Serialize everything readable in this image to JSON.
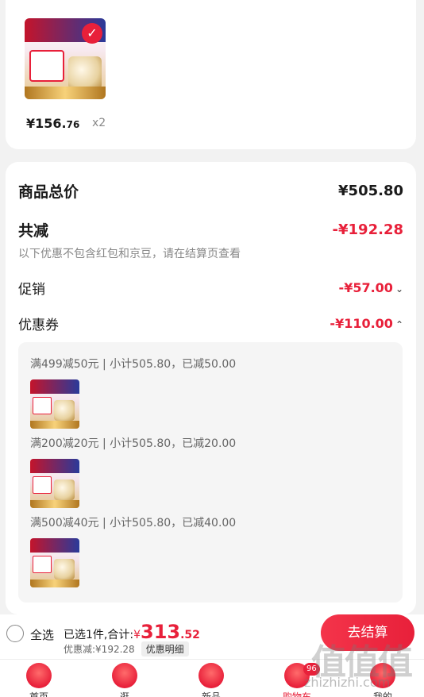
{
  "product": {
    "price_main": "¥156.",
    "price_dec": "76",
    "quantity": "x2"
  },
  "summary": {
    "total_label": "商品总价",
    "total_value": "¥505.80",
    "reduce_label": "共减",
    "reduce_value": "-¥192.28",
    "note": "以下优惠不包含红包和京豆，请在结算页查看",
    "promo_label": "促销",
    "promo_value": "-¥57.00",
    "promo_chevron": "⌄",
    "coupon_label": "优惠券",
    "coupon_value": "-¥110.00",
    "coupon_chevron": "⌃"
  },
  "coupons": [
    {
      "text": "满499减50元 | 小计505.80，已减50.00"
    },
    {
      "text": "满200减20元 | 小计505.80，已减20.00"
    },
    {
      "text": "满500减40元 | 小计505.80，已减40.00"
    }
  ],
  "bottom_bar": {
    "select_all": "全选",
    "selected_text": "已选1件,合计:",
    "currency": "¥",
    "amount_int": "313",
    "amount_dec": ".52",
    "discount_text": "优惠减:¥192.28",
    "detail_chip": "优惠明细",
    "checkout": "去结算"
  },
  "tabbar": {
    "tabs": [
      {
        "label": "首页",
        "icon": "home-icon"
      },
      {
        "label": "逛",
        "icon": "explore-icon"
      },
      {
        "label": "新品",
        "icon": "new-product-icon"
      },
      {
        "label": "购物车",
        "icon": "cart-icon",
        "badge": "96"
      },
      {
        "label": "我的",
        "icon": "profile-icon"
      }
    ]
  },
  "watermark": {
    "text": "值值值",
    "url": "zhizhizhi.com"
  },
  "colors": {
    "accent": "#e8203a",
    "background": "#f2f2f2"
  }
}
